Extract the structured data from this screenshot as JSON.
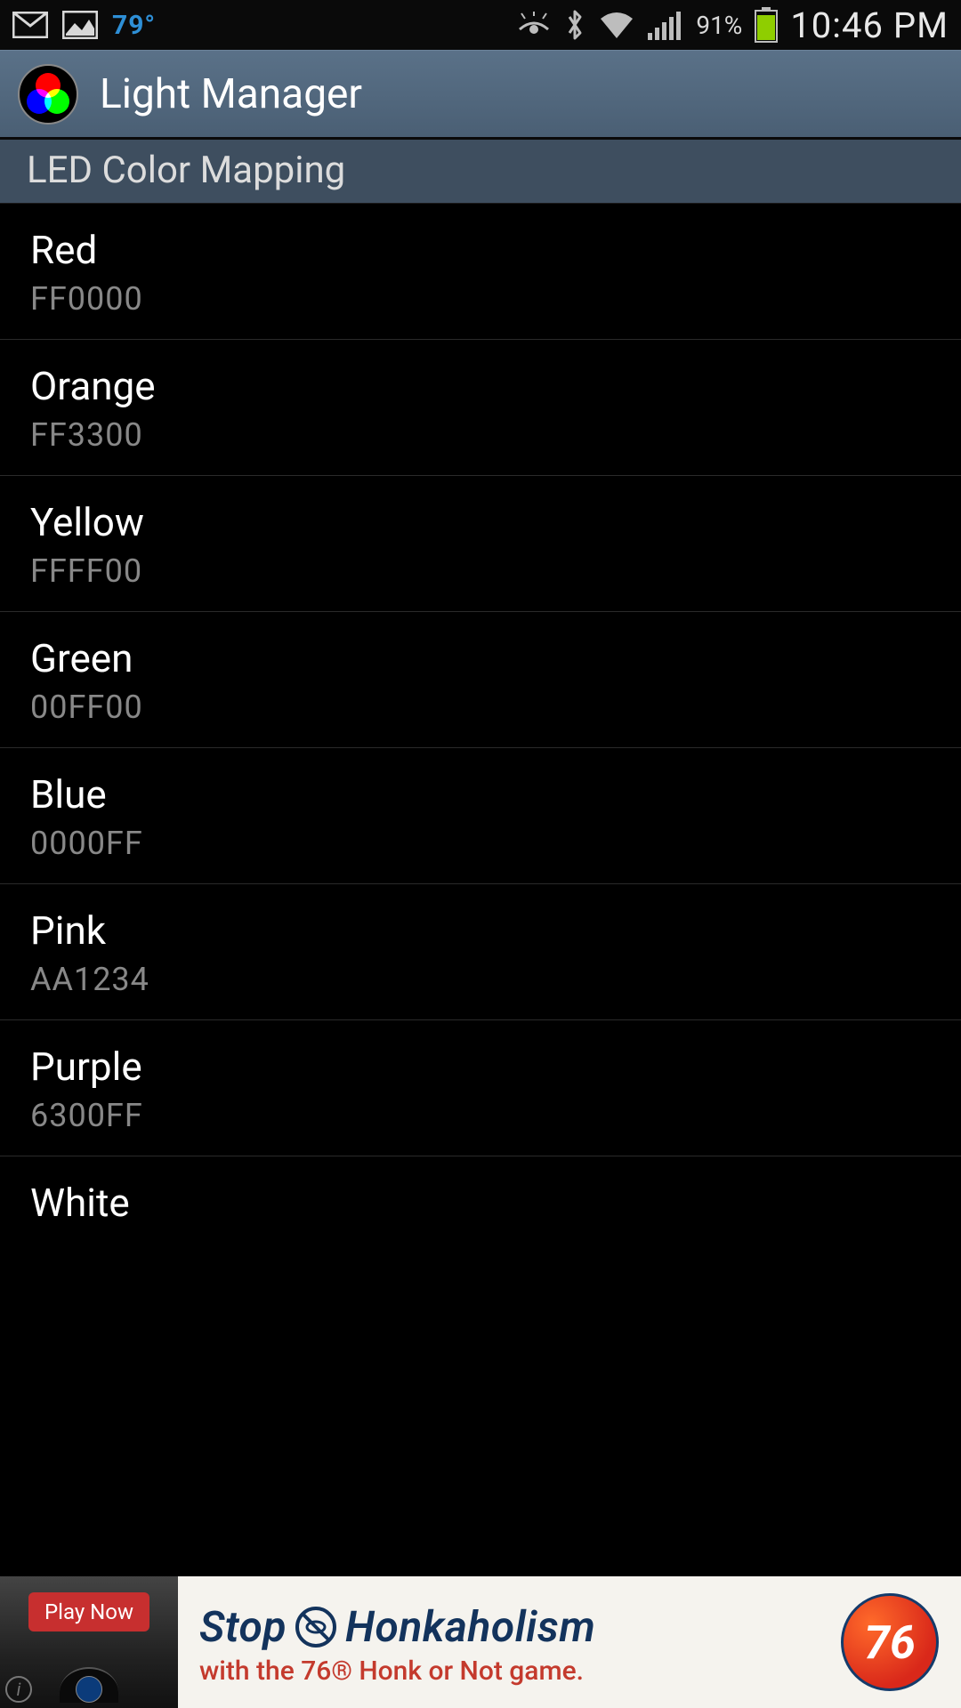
{
  "status": {
    "temp": "79°",
    "battery_pct": "91%",
    "time": "10:46 PM"
  },
  "app": {
    "title": "Light Manager"
  },
  "section": {
    "header": "LED Color Mapping"
  },
  "colors": [
    {
      "name": "Red",
      "hex": "FF0000"
    },
    {
      "name": "Orange",
      "hex": "FF3300"
    },
    {
      "name": "Yellow",
      "hex": "FFFF00"
    },
    {
      "name": "Green",
      "hex": "00FF00"
    },
    {
      "name": "Blue",
      "hex": "0000FF"
    },
    {
      "name": "Pink",
      "hex": "AA1234"
    },
    {
      "name": "Purple",
      "hex": "6300FF"
    },
    {
      "name": "White",
      "hex": ""
    }
  ],
  "ad": {
    "cta": "Play Now",
    "headline_left": "Stop",
    "headline_right": "Honkaholism",
    "subline": "with the 76® Honk or Not game.",
    "brand": "76"
  }
}
